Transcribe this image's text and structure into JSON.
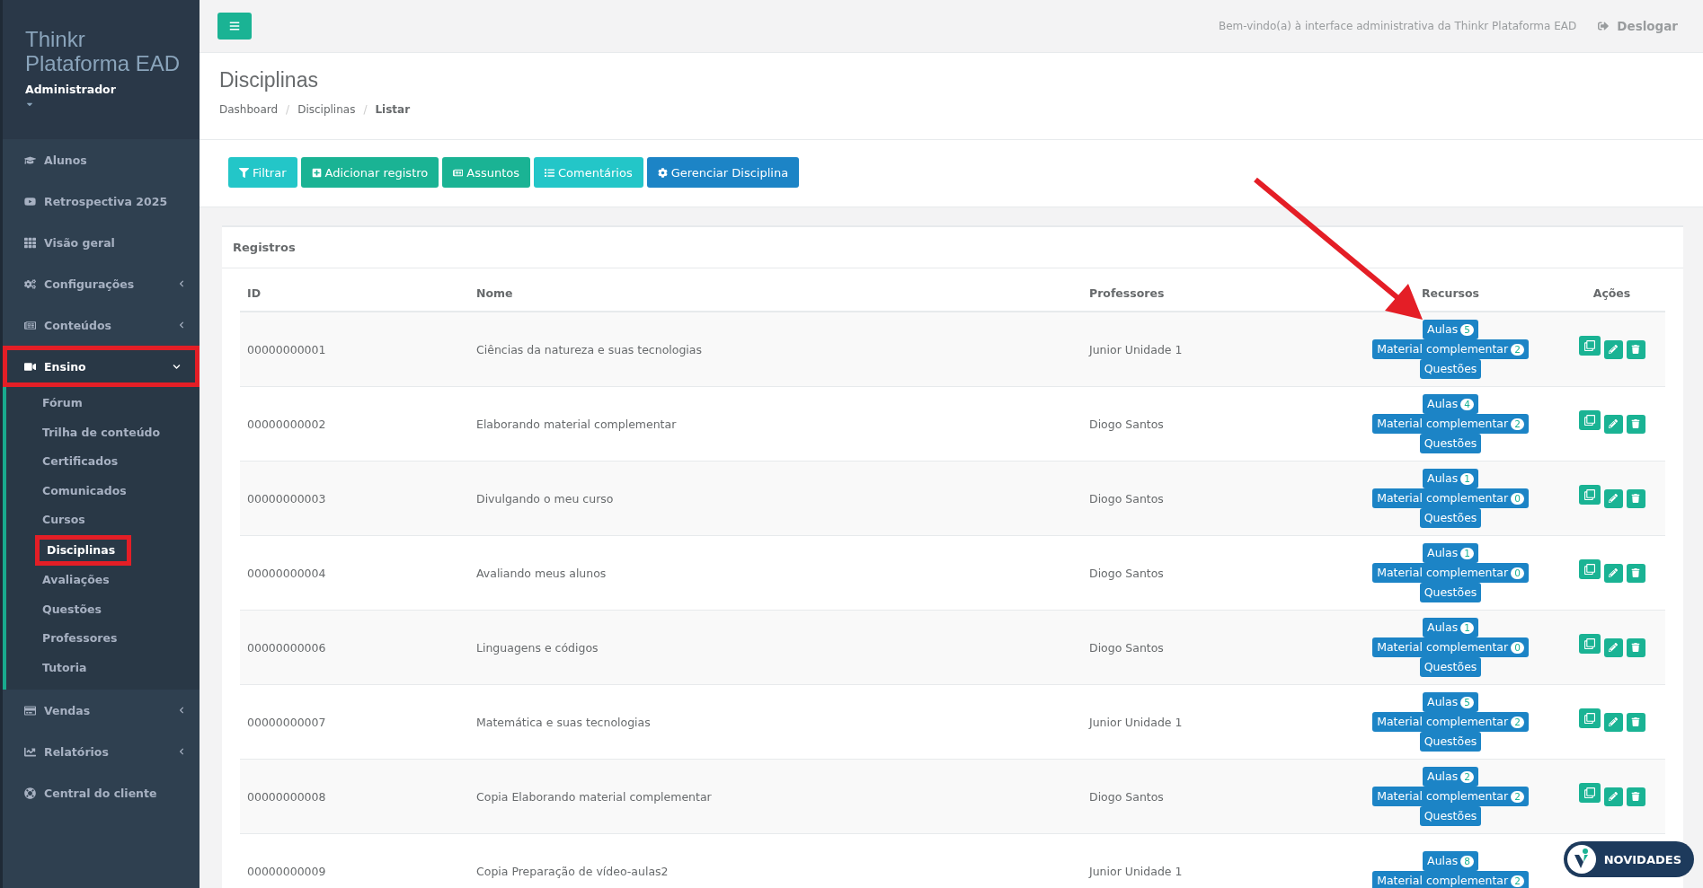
{
  "sidebar": {
    "brand": [
      "Thinkr",
      "Plataforma EAD"
    ],
    "role": "Administrador",
    "items": [
      {
        "label": "Alunos",
        "selected": false,
        "annotated": false
      },
      {
        "label": "Retrospectiva 2025",
        "selected": false,
        "annotated": false
      },
      {
        "label": "Visão geral",
        "selected": false,
        "annotated": false
      },
      {
        "label": "Configurações",
        "selected": false,
        "annotated": false,
        "expanded": false
      },
      {
        "label": "Conteúdos",
        "selected": false,
        "annotated": false,
        "expanded": false
      },
      {
        "label": "Ensino",
        "selected": true,
        "annotated": true,
        "expanded": true,
        "children": [
          {
            "label": "Fórum",
            "selected": false,
            "annotated": false
          },
          {
            "label": "Trilha de conteúdo",
            "selected": false,
            "annotated": false
          },
          {
            "label": "Certificados",
            "selected": false,
            "annotated": false
          },
          {
            "label": "Comunicados",
            "selected": false,
            "annotated": false
          },
          {
            "label": "Cursos",
            "selected": false,
            "annotated": false
          },
          {
            "label": "Disciplinas",
            "selected": true,
            "annotated": true
          },
          {
            "label": "Avaliações",
            "selected": false,
            "annotated": false
          },
          {
            "label": "Questões",
            "selected": false,
            "annotated": false
          },
          {
            "label": "Professores",
            "selected": false,
            "annotated": false
          },
          {
            "label": "Tutoria",
            "selected": false,
            "annotated": false
          }
        ]
      },
      {
        "label": "Vendas",
        "selected": false,
        "annotated": false,
        "expanded": false
      },
      {
        "label": "Relatórios",
        "selected": false,
        "annotated": false,
        "expanded": false
      },
      {
        "label": "Central do cliente",
        "selected": false,
        "annotated": false
      }
    ]
  },
  "topbar": {
    "welcome": "Bem-vindo(a) à interface administrativa da Thinkr Plataforma EAD",
    "logout": "Deslogar"
  },
  "page": {
    "title": "Disciplinas",
    "breadcrumb": [
      {
        "label": "Dashboard",
        "current": false
      },
      {
        "separator": "/"
      },
      {
        "label": "Disciplinas",
        "current": false
      },
      {
        "separator": "/"
      },
      {
        "label": "Listar",
        "current": true
      }
    ]
  },
  "toolbar": [
    {
      "label": "Filtrar",
      "kind": "info"
    },
    {
      "label": "Adicionar registro",
      "kind": "primary"
    },
    {
      "label": "Assuntos",
      "kind": "primary"
    },
    {
      "label": "Comentários",
      "kind": "info"
    },
    {
      "label": "Gerenciar Disciplina",
      "kind": "success"
    }
  ],
  "panel": {
    "title": "Registros"
  },
  "table": {
    "columns": [
      "ID",
      "Nome",
      "Professores",
      "Recursos",
      "Ações"
    ],
    "rows": [
      {
        "id": "00000000001",
        "name": "Ciências da natureza e suas tecnologias",
        "teacher": "Junior Unidade 1",
        "resources": [
          {
            "label": "Aulas",
            "count": "5"
          },
          {
            "label": "Material complementar",
            "count": "2"
          },
          {
            "label": "Questões"
          }
        ],
        "actions": [
          {
            "kind": "copy"
          },
          {
            "kind": "edit"
          },
          {
            "kind": "delete"
          }
        ]
      },
      {
        "id": "00000000002",
        "name": "Elaborando material complementar",
        "teacher": "Diogo Santos",
        "resources": [
          {
            "label": "Aulas",
            "count": "4"
          },
          {
            "label": "Material complementar",
            "count": "2"
          },
          {
            "label": "Questões"
          }
        ],
        "actions": [
          {
            "kind": "copy"
          },
          {
            "kind": "edit"
          },
          {
            "kind": "delete"
          }
        ]
      },
      {
        "id": "00000000003",
        "name": "Divulgando o meu curso",
        "teacher": "Diogo Santos",
        "resources": [
          {
            "label": "Aulas",
            "count": "1"
          },
          {
            "label": "Material complementar",
            "count": "0"
          },
          {
            "label": "Questões"
          }
        ],
        "actions": [
          {
            "kind": "copy"
          },
          {
            "kind": "edit"
          },
          {
            "kind": "delete"
          }
        ]
      },
      {
        "id": "00000000004",
        "name": "Avaliando meus alunos",
        "teacher": "Diogo Santos",
        "resources": [
          {
            "label": "Aulas",
            "count": "1"
          },
          {
            "label": "Material complementar",
            "count": "0"
          },
          {
            "label": "Questões"
          }
        ],
        "actions": [
          {
            "kind": "copy"
          },
          {
            "kind": "edit"
          },
          {
            "kind": "delete"
          }
        ]
      },
      {
        "id": "00000000006",
        "name": "Linguagens e códigos",
        "teacher": "Diogo Santos",
        "resources": [
          {
            "label": "Aulas",
            "count": "1"
          },
          {
            "label": "Material complementar",
            "count": "0"
          },
          {
            "label": "Questões"
          }
        ],
        "actions": [
          {
            "kind": "copy"
          },
          {
            "kind": "edit"
          },
          {
            "kind": "delete"
          }
        ]
      },
      {
        "id": "00000000007",
        "name": "Matemática e suas tecnologias",
        "teacher": "Junior Unidade 1",
        "resources": [
          {
            "label": "Aulas",
            "count": "5"
          },
          {
            "label": "Material complementar",
            "count": "2"
          },
          {
            "label": "Questões"
          }
        ],
        "actions": [
          {
            "kind": "copy"
          },
          {
            "kind": "edit"
          },
          {
            "kind": "delete"
          }
        ]
      },
      {
        "id": "00000000008",
        "name": "Copia Elaborando material complementar",
        "teacher": "Diogo Santos",
        "resources": [
          {
            "label": "Aulas",
            "count": "2"
          },
          {
            "label": "Material complementar",
            "count": "2"
          },
          {
            "label": "Questões"
          }
        ],
        "actions": [
          {
            "kind": "copy"
          },
          {
            "kind": "edit"
          },
          {
            "kind": "delete"
          }
        ]
      },
      {
        "id": "00000000009",
        "name": "Copia Preparação de vídeo-aulas2",
        "teacher": "Junior Unidade 1",
        "resources": [
          {
            "label": "Aulas",
            "count": "8"
          },
          {
            "label": "Material complementar",
            "count": "2"
          }
        ]
      }
    ]
  },
  "news_button": {
    "label": "NOVIDADES"
  },
  "annotation_arrow": true
}
